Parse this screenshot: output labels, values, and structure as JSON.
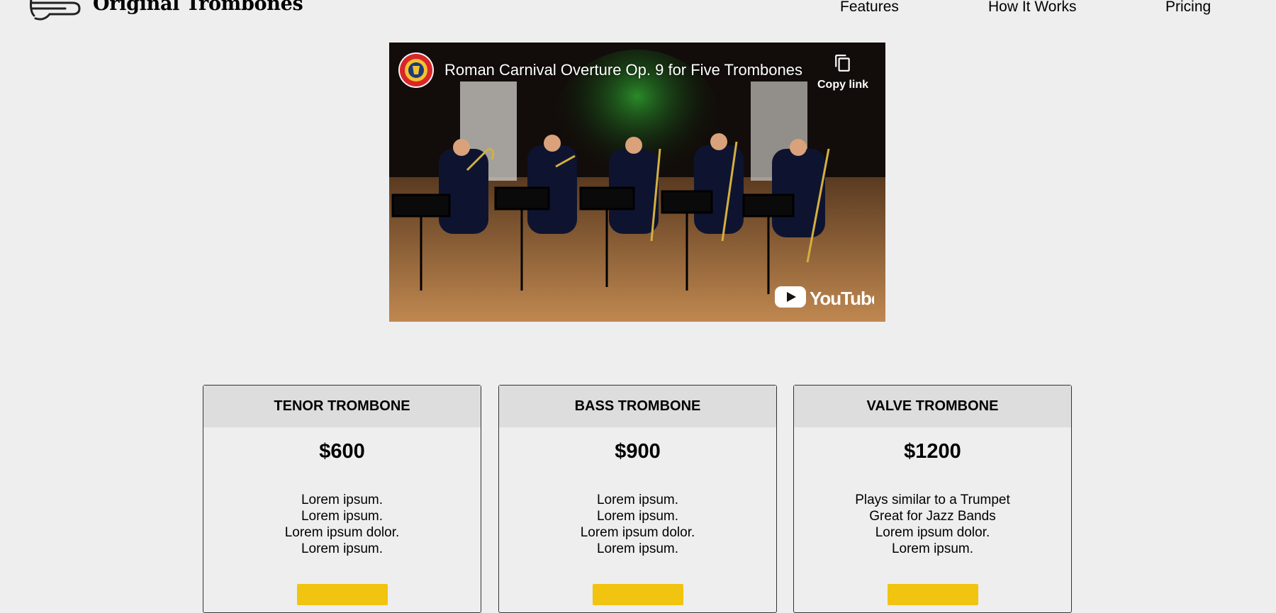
{
  "header": {
    "brand": "Original Trombones",
    "logo_icon": "trombone-icon",
    "nav": [
      "Features",
      "How It Works",
      "Pricing"
    ]
  },
  "video": {
    "title": "Roman Carnival Overture Op. 9 for Five Trombones",
    "copy_link_label": "Copy link",
    "copy_icon": "copy-icon",
    "brand_logo": "YouTube"
  },
  "pricing": [
    {
      "name": "TENOR TROMBONE",
      "price": "$600",
      "features": [
        "Lorem ipsum.",
        "Lorem ipsum.",
        "Lorem ipsum dolor.",
        "Lorem ipsum."
      ]
    },
    {
      "name": "BASS TROMBONE",
      "price": "$900",
      "features": [
        "Lorem ipsum.",
        "Lorem ipsum.",
        "Lorem ipsum dolor.",
        "Lorem ipsum."
      ]
    },
    {
      "name": "VALVE TROMBONE",
      "price": "$1200",
      "features": [
        "Plays similar to a Trumpet",
        "Great for Jazz Bands",
        "Lorem ipsum dolor.",
        "Lorem ipsum."
      ]
    }
  ],
  "colors": {
    "background": "#eeeeee",
    "card_header": "#dddddd",
    "button": "#f1c40f"
  }
}
